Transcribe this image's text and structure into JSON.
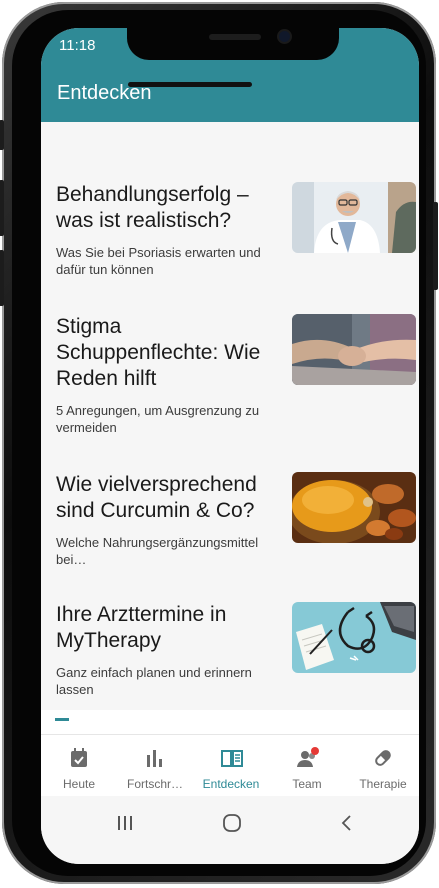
{
  "status": {
    "time": "11:18"
  },
  "appbar": {
    "title": "Entdecken"
  },
  "articles": [
    {
      "title": "Behandlungserfolg – was ist realistisch?",
      "subtitle": "Was Sie bei Psoriasis erwarten und dafür tun können"
    },
    {
      "title": "Stigma Schuppenflechte: Wie Reden hilft",
      "subtitle": "5 Anregungen, um Ausgrenzung zu vermeiden"
    },
    {
      "title": "Wie vielversprechend sind Curcumin & Co?",
      "subtitle": "Welche Nahrungsergänzungsmittel bei…"
    },
    {
      "title": "Ihre Arzttermine in MyTherapy",
      "subtitle": "Ganz einfach planen und erinnern lassen"
    }
  ],
  "bottom_nav": [
    {
      "label": "Heute",
      "icon": "calendar-check-icon"
    },
    {
      "label": "Fortschr…",
      "icon": "bar-chart-icon"
    },
    {
      "label": "Entdecken",
      "icon": "book-icon"
    },
    {
      "label": "Team",
      "icon": "people-icon"
    },
    {
      "label": "Therapie",
      "icon": "pill-icon"
    }
  ],
  "colors": {
    "primary": "#2f8a96",
    "badge": "#e53935"
  }
}
